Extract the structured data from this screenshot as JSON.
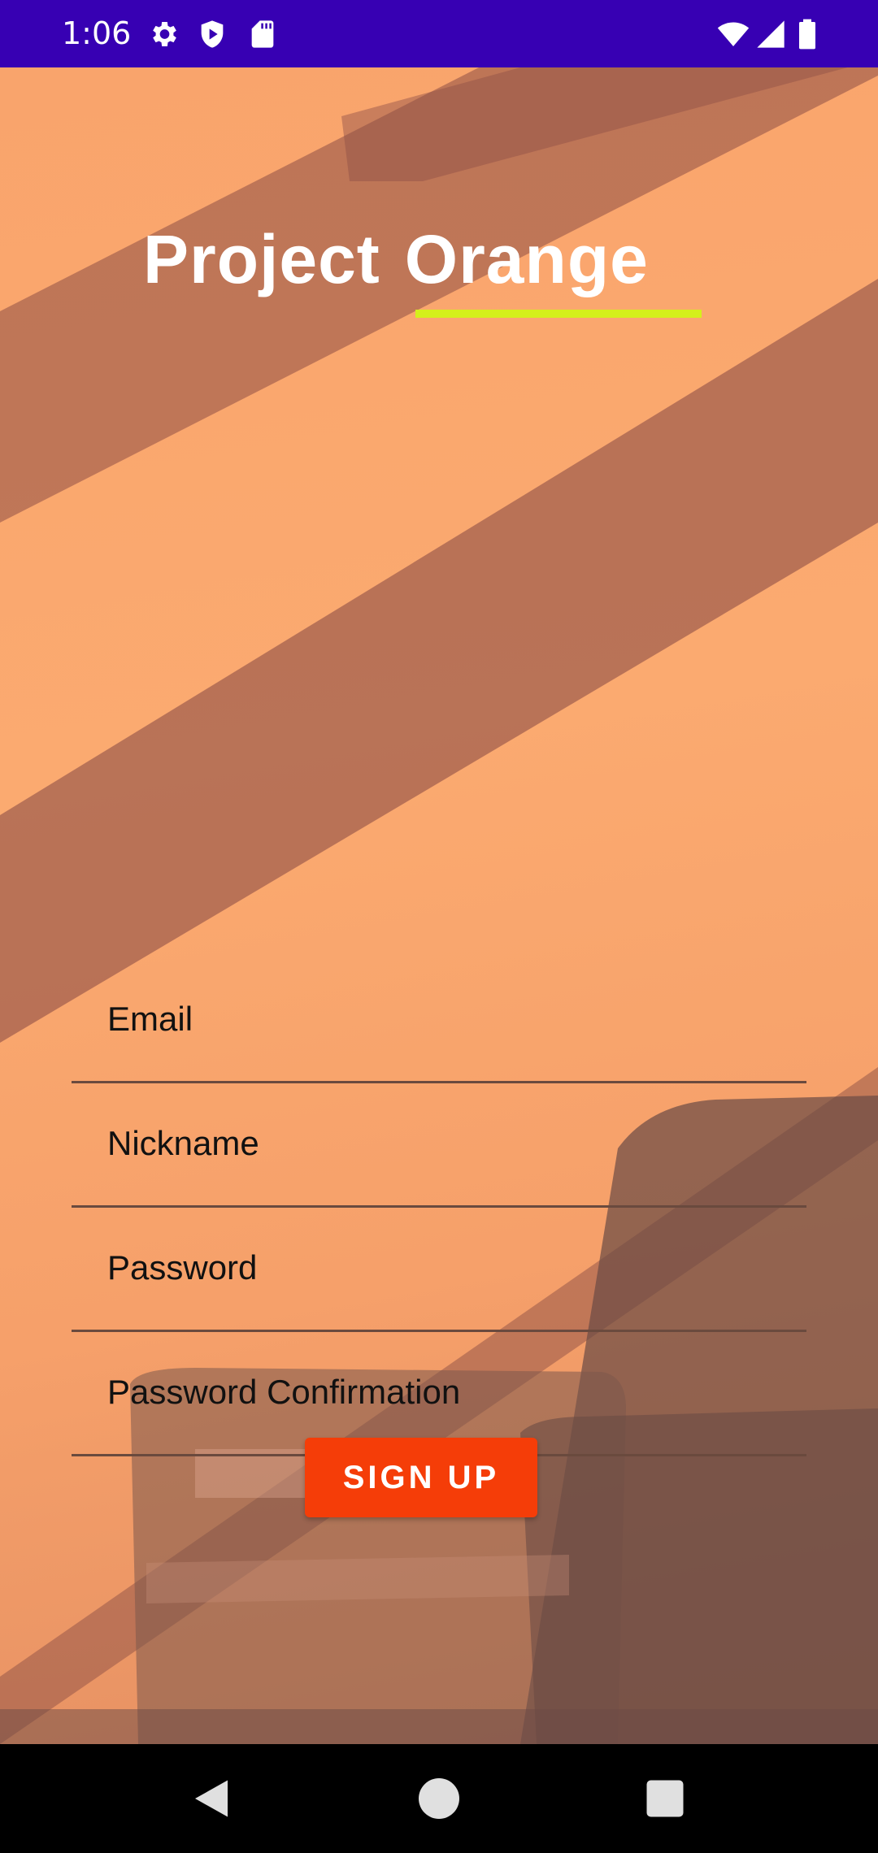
{
  "status_bar": {
    "time": "1:06",
    "icons": [
      "gear-icon",
      "shield-play-icon",
      "sd-card-icon",
      "wifi-icon",
      "cellular-signal-icon",
      "battery-icon"
    ]
  },
  "header": {
    "title_word_1": "Project",
    "title_word_2": "Orange",
    "underline_color": "#d4f01b"
  },
  "form": {
    "email": {
      "placeholder": "Email",
      "value": ""
    },
    "nickname": {
      "placeholder": "Nickname",
      "value": ""
    },
    "password": {
      "placeholder": "Password",
      "value": ""
    },
    "password_confirmation": {
      "placeholder": "Password Confirmation",
      "value": ""
    },
    "signup_label": "SIGN UP"
  },
  "colors": {
    "status_bar": "#3700B3",
    "background": "#fba86f",
    "button": "#f53d08"
  },
  "nav_bar": {
    "buttons": [
      "back-icon",
      "home-icon",
      "recents-icon"
    ]
  }
}
